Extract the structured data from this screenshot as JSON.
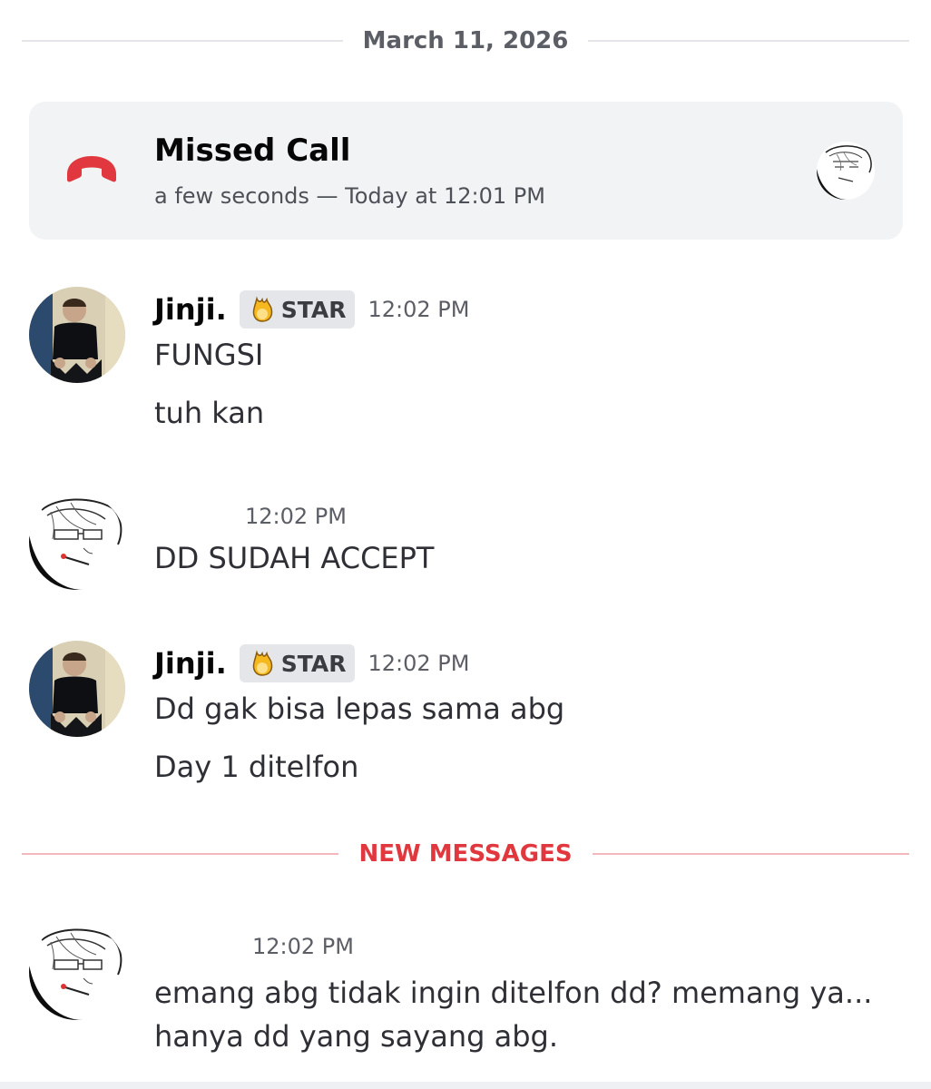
{
  "date_divider": "March 11, 2026",
  "missed_call": {
    "title": "Missed Call",
    "subtitle": "a few seconds — Today at 12:01 PM",
    "icon": "phone-hangup-icon",
    "icon_color": "#e0383e"
  },
  "messages": [
    {
      "author": "Jinji.",
      "badge": "STAR",
      "time": "12:02 PM",
      "lines": [
        "FUNGSI",
        "tuh kan"
      ]
    },
    {
      "author": "",
      "time": "12:02 PM",
      "lines": [
        "DD SUDAH ACCEPT"
      ]
    },
    {
      "author": "Jinji.",
      "badge": "STAR",
      "time": "12:02 PM",
      "lines": [
        "Dd gak bisa lepas sama abg",
        "Day 1 ditelfon"
      ]
    }
  ],
  "new_messages_divider": "NEW MESSAGES",
  "new_message": {
    "author": "",
    "time": "12:02 PM",
    "text": "emang abg tidak ingin ditelfon dd? memang ya... hanya dd yang sayang abg."
  },
  "colors": {
    "accent_red": "#e0383e",
    "card_bg": "#f2f3f5",
    "badge_bg": "#e5e6e9"
  }
}
